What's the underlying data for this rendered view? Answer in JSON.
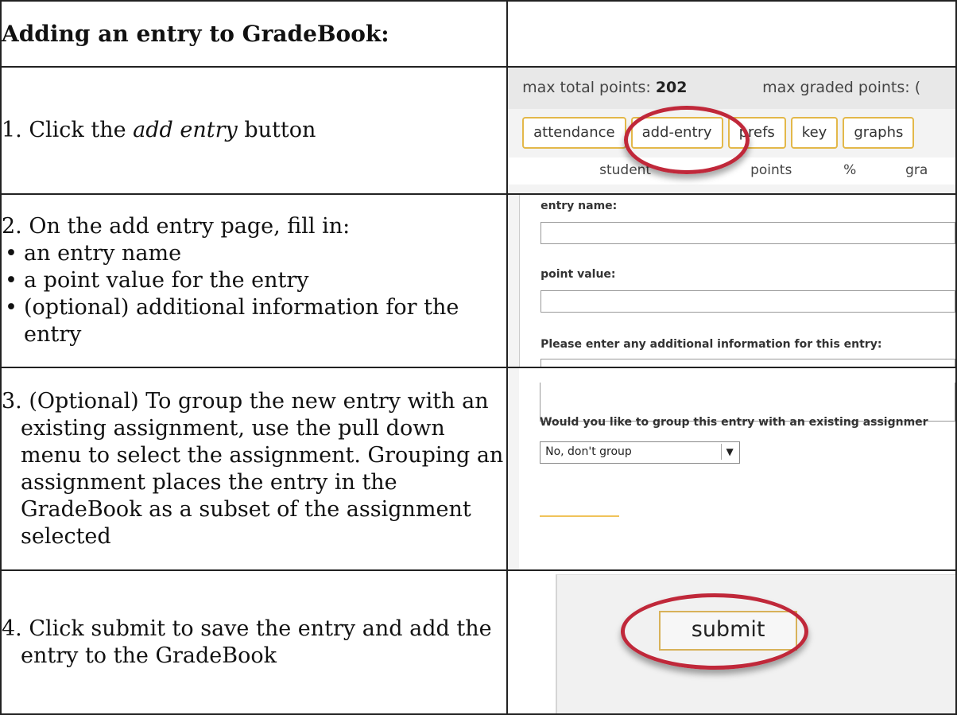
{
  "header": {
    "title": "Adding an entry to GradeBook:"
  },
  "step1": {
    "prefix": "1. Click the ",
    "emph": "add entry",
    "suffix": " button",
    "shot": {
      "max_total_label": "max total points: ",
      "max_total_value": "202",
      "max_graded_label": "max graded points: (",
      "tabs": [
        "attendance",
        "add-entry",
        "prefs",
        "key",
        "graphs"
      ],
      "columns": [
        "student",
        "points",
        "%",
        "gra"
      ]
    }
  },
  "step2": {
    "intro": "2. On the add entry page, fill in:",
    "bullets": [
      "an entry name",
      "a point value for the entry",
      "(optional) additional information for the entry"
    ],
    "shot": {
      "entry_name_label": "entry name:",
      "point_value_label": "point value:",
      "additional_label": "Please enter any additional information for this entry:"
    }
  },
  "step3": {
    "text": "3. (Optional) To group the new entry with an existing assignment, use the pull down menu to select the assignment. Grouping an assignment places the entry in the GradeBook as a subset of the assignment selected",
    "shot": {
      "question": "Would you like to group this entry with an existing assignmer",
      "select_value": "No, don't group"
    }
  },
  "step4": {
    "text": "4. Click submit to save the entry and add the entry to the GradeBook",
    "shot": {
      "submit_label": "submit"
    }
  },
  "colors": {
    "highlight_ring": "#c0283a",
    "tab_border": "#e3b84a"
  }
}
